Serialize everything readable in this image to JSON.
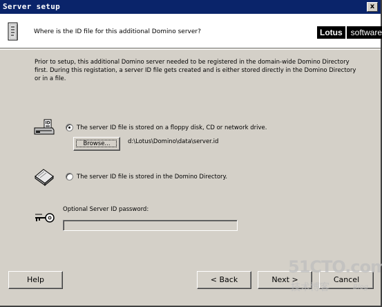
{
  "window": {
    "title": "Server setup",
    "close_label": "x"
  },
  "header": {
    "question": "Where is the ID file for this additional Domino server?",
    "logo": {
      "brand": "Lotus",
      "product": "software"
    }
  },
  "intro": "Prior to setup, this additional Domino server needed to be registered in the domain-wide Domino Directory first. During this registation, a server ID file gets created and is either stored directly in the Domino Directory or in a file.",
  "options": {
    "file": {
      "label": "The server ID file is stored on a floppy disk, CD or network drive.",
      "selected": true,
      "browse_label": "Browse...",
      "path": "d:\\Lotus\\Domino\\data\\server.id"
    },
    "directory": {
      "label": "The server ID file is stored in the Domino Directory.",
      "selected": false
    }
  },
  "password": {
    "label": "Optional Server ID password:",
    "value": ""
  },
  "buttons": {
    "help": "Help",
    "back": "< Back",
    "next": "Next >",
    "cancel": "Cancel"
  },
  "watermark": {
    "site": "51CTO.com",
    "tagline": "技术博客",
    "blog": "Blog"
  },
  "icons": {
    "doc": "document-icon",
    "floppy": "id-card-drive-icon",
    "directory": "directory-book-icon",
    "key": "key-icon"
  }
}
